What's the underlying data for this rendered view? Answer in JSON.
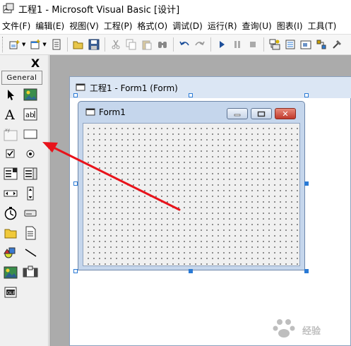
{
  "window": {
    "title": "工程1 - Microsoft Visual Basic [设计]",
    "app_icon": "vb-app-icon"
  },
  "menu": [
    {
      "label": "文件(F)"
    },
    {
      "label": "编辑(E)"
    },
    {
      "label": "视图(V)"
    },
    {
      "label": "工程(P)"
    },
    {
      "label": "格式(O)"
    },
    {
      "label": "调试(D)"
    },
    {
      "label": "运行(R)"
    },
    {
      "label": "查询(U)"
    },
    {
      "label": "图表(I)"
    },
    {
      "label": "工具(T)"
    }
  ],
  "toolbox": {
    "close_label": "X",
    "tab_label": "General",
    "tools": [
      "pointer-icon",
      "picturebox-icon",
      "label-icon",
      "textbox-icon",
      "frame-icon",
      "commandbutton-icon",
      "checkbox-icon",
      "optionbutton-icon",
      "combobox-icon",
      "listbox-icon",
      "hscrollbar-icon",
      "vscrollbar-icon",
      "timer-icon",
      "drivelistbox-icon",
      "dirlistbox-icon",
      "filelistbox-icon",
      "shape-icon",
      "line-icon",
      "image-icon",
      "data-icon",
      "ole-icon"
    ]
  },
  "project_window": {
    "title": "工程1 - Form1 (Form)"
  },
  "form": {
    "title": "Form1",
    "close_glyph": "✕"
  },
  "watermark": {
    "text": "经验"
  },
  "colors": {
    "selection_handle": "#2a7ad5",
    "arrow": "#e8131b",
    "form_border": "#c5d6ec",
    "workspace": "#ababab"
  }
}
